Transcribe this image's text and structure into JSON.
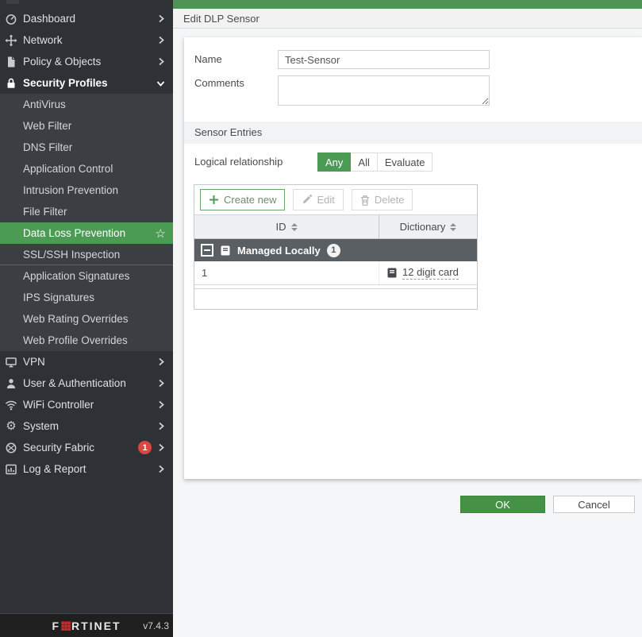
{
  "colors": {
    "accent_green": "#4c9b55",
    "ok_green": "#459247",
    "topbar_green": "#4f9355",
    "sidebar_bg": "#2e3236",
    "submenu_bg": "#3b3f44",
    "group_row_bg": "#5a5f64",
    "badge_red": "#dc4543",
    "logo_red": "#c42f2f"
  },
  "sidebar": {
    "top_items": [
      {
        "label": "Dashboard"
      },
      {
        "label": "Network"
      },
      {
        "label": "Policy & Objects"
      },
      {
        "label": "Security Profiles"
      }
    ],
    "security_profiles_submenu": [
      {
        "label": "AntiVirus"
      },
      {
        "label": "Web Filter"
      },
      {
        "label": "DNS Filter"
      },
      {
        "label": "Application Control"
      },
      {
        "label": "Intrusion Prevention"
      },
      {
        "label": "File Filter"
      },
      {
        "label": "Data Loss Prevention"
      },
      {
        "label": "SSL/SSH Inspection"
      },
      {
        "label": "Application Signatures"
      },
      {
        "label": "IPS Signatures"
      },
      {
        "label": "Web Rating Overrides"
      },
      {
        "label": "Web Profile Overrides"
      }
    ],
    "bottom_items": [
      {
        "label": "VPN"
      },
      {
        "label": "User & Authentication"
      },
      {
        "label": "WiFi Controller"
      },
      {
        "label": "System"
      },
      {
        "label": "Security Fabric",
        "badge": "1"
      },
      {
        "label": "Log & Report"
      }
    ],
    "active_item": "Data Loss Prevention",
    "footer": {
      "logo_left": "F",
      "logo_right": "RTINET",
      "version": "v7.4.3"
    }
  },
  "header": {
    "title": "Edit DLP Sensor"
  },
  "form": {
    "name_label": "Name",
    "name_value": "Test-Sensor",
    "comments_label": "Comments",
    "comments_value": ""
  },
  "sensor_entries": {
    "section_title": "Sensor Entries",
    "logical_relationship_label": "Logical relationship",
    "logical_options": [
      "Any",
      "All",
      "Evaluate"
    ],
    "logical_selected": "Any",
    "toolbar": {
      "create_label": "Create new",
      "edit_label": "Edit",
      "delete_label": "Delete"
    },
    "table": {
      "columns": [
        "ID",
        "Dictionary"
      ],
      "group": {
        "label": "Managed Locally",
        "count": "1"
      },
      "rows": [
        {
          "id": "1",
          "dictionary": "12 digit card"
        }
      ]
    }
  },
  "actions": {
    "ok_label": "OK",
    "cancel_label": "Cancel"
  }
}
